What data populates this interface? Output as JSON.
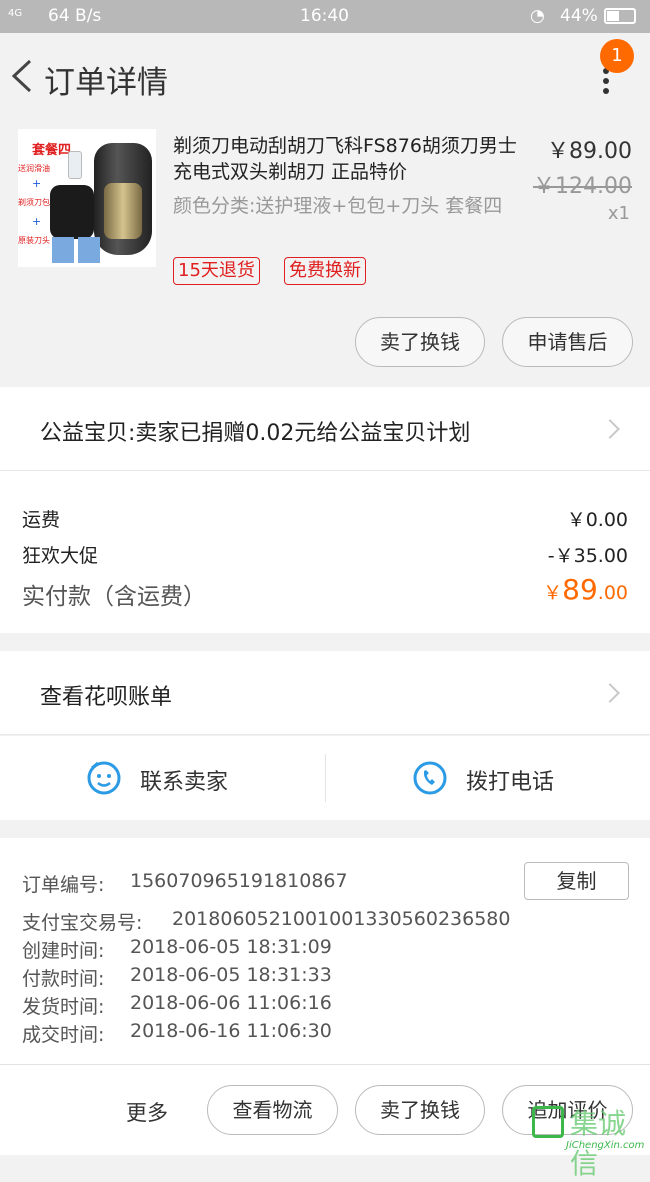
{
  "status_bar": {
    "signal": "4G",
    "net_speed": "64 B/s",
    "time": "16:40",
    "battery": "44%"
  },
  "header": {
    "title": "订单详情",
    "badge_count": "1"
  },
  "product": {
    "thumb_label": "套餐四",
    "thumb_items": [
      "送润滑油",
      "剃须刀包",
      "原装刀头"
    ],
    "thumb_plus": "+",
    "name": "剃须刀电动刮胡刀飞科FS876胡须刀男士充电式双头剃胡刀 正品特价",
    "sku": "颜色分类:送护理液+包包+刀头 套餐四",
    "price": "￥89.00",
    "original_price": "￥124.00",
    "quantity": "x1",
    "tags": [
      "15天退货",
      "免费换新"
    ],
    "actions": [
      "卖了换钱",
      "申请售后"
    ]
  },
  "charity": {
    "text": "公益宝贝:卖家已捐赠0.02元给公益宝贝计划"
  },
  "fees": {
    "shipping_label": "运费",
    "shipping_value": "￥0.00",
    "promo_label": "狂欢大促",
    "promo_value": "-￥35.00",
    "total_label": "实付款（含运费）",
    "total_symbol": "￥",
    "total_int": "89",
    "total_dec": ".00"
  },
  "huabei": {
    "text": "查看花呗账单"
  },
  "contact": {
    "seller": "联系卖家",
    "phone": "拨打电话"
  },
  "order_info": {
    "copy_label": "复制",
    "rows": [
      {
        "label": "订单编号:",
        "value": "156070965191810867"
      },
      {
        "label": "支付宝交易号:",
        "value": "2018060521001001330560236580"
      },
      {
        "label": "创建时间:",
        "value": "2018-06-05 18:31:09"
      },
      {
        "label": "付款时间:",
        "value": "2018-06-05 18:31:33"
      },
      {
        "label": "发货时间:",
        "value": "2018-06-06 11:06:16"
      },
      {
        "label": "成交时间:",
        "value": "2018-06-16 11:06:30"
      }
    ]
  },
  "bottom_bar": {
    "more": "更多",
    "buttons": [
      "查看物流",
      "卖了换钱",
      "追加评价"
    ]
  },
  "watermark": {
    "main": "集诚信",
    "sub": "JiChengXin.com"
  },
  "colors": {
    "accent": "#ff6a00",
    "tag_red": "#e02020",
    "icon_blue": "#2c9be6"
  }
}
